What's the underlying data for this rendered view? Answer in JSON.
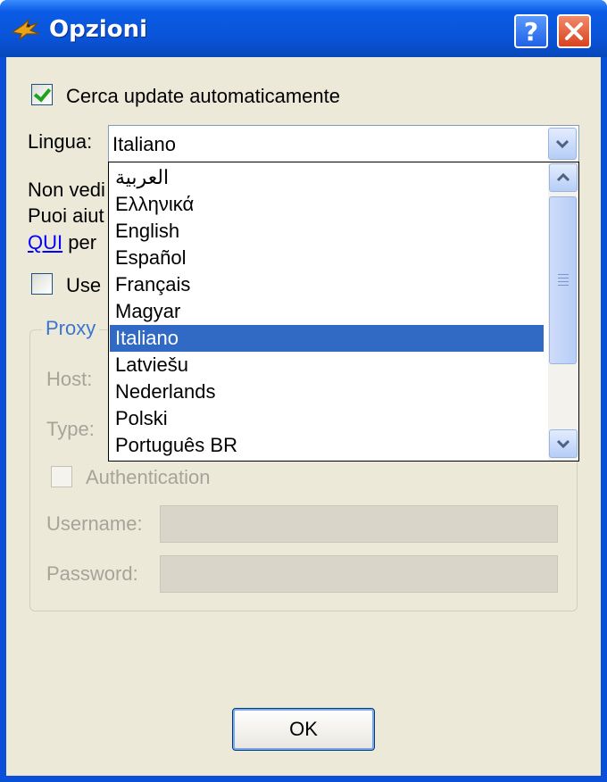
{
  "window": {
    "title": "Opzioni",
    "help_glyph": "?",
    "close_glyph": "✕"
  },
  "general": {
    "auto_update_label": "Cerca update automaticamente",
    "auto_update_checked": true,
    "language_label": "Lingua:",
    "language_value": "Italiano",
    "info_line1": "Non vedi",
    "info_line2": "Puoi aiut",
    "info_link": "QUI",
    "info_line3_rest": " per",
    "use_proxy_label": "Use"
  },
  "language_options": [
    "العربية",
    "Ελληνικά",
    "English",
    "Español",
    "Français",
    "Magyar",
    "Italiano",
    "Latviešu",
    "Nederlands",
    "Polski",
    "Português BR"
  ],
  "selected_index": 6,
  "proxy": {
    "group_title": "Proxy",
    "host_label": "Host:",
    "type_label": "Type:",
    "auth_label": "Authentication",
    "username_label": "Username:",
    "password_label": "Password:"
  },
  "ok_label": "OK",
  "colors": {
    "titlebar": "#0a53d6",
    "selection": "#316ac5",
    "link": "#0000ff",
    "client": "#ece9d8"
  },
  "icons": {
    "app": "swallow-icon",
    "help": "help-icon",
    "close": "close-icon"
  }
}
